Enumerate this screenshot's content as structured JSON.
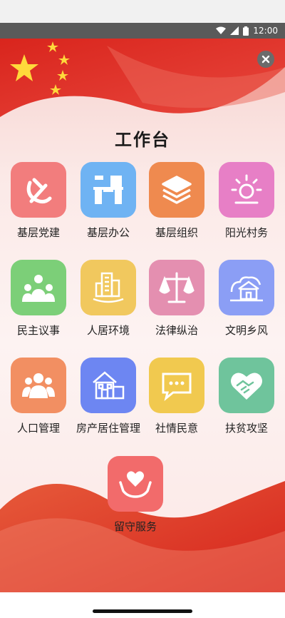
{
  "status_bar": {
    "time": "12:00"
  },
  "page": {
    "title": "工作台"
  },
  "tiles": [
    {
      "label": "基层党建",
      "icon": "party-emblem-icon",
      "color": "#f27d7d"
    },
    {
      "label": "基层办公",
      "icon": "office-desk-icon",
      "color": "#6fb3f3"
    },
    {
      "label": "基层组织",
      "icon": "layers-icon",
      "color": "#ef8a4f"
    },
    {
      "label": "阳光村务",
      "icon": "sun-icon",
      "color": "#e77fc6"
    },
    {
      "label": "民主议事",
      "icon": "group-meeting-icon",
      "color": "#7ccf78"
    },
    {
      "label": "人居环境",
      "icon": "buildings-icon",
      "color": "#f1c85e"
    },
    {
      "label": "法律纵治",
      "icon": "scales-icon",
      "color": "#e48fb0"
    },
    {
      "label": "文明乡风",
      "icon": "village-house-icon",
      "color": "#8b9ef5"
    },
    {
      "label": "人口管理",
      "icon": "people-icon",
      "color": "#f28f62"
    },
    {
      "label": "房产居住管理",
      "icon": "house-icon",
      "color": "#6d86f2"
    },
    {
      "label": "社情民意",
      "icon": "chat-bubble-icon",
      "color": "#f1c94f"
    },
    {
      "label": "扶贫攻坚",
      "icon": "handshake-heart-icon",
      "color": "#6fc49c"
    },
    {
      "label": "留守服务",
      "icon": "heart-hands-icon",
      "color": "#f26b6b"
    }
  ]
}
